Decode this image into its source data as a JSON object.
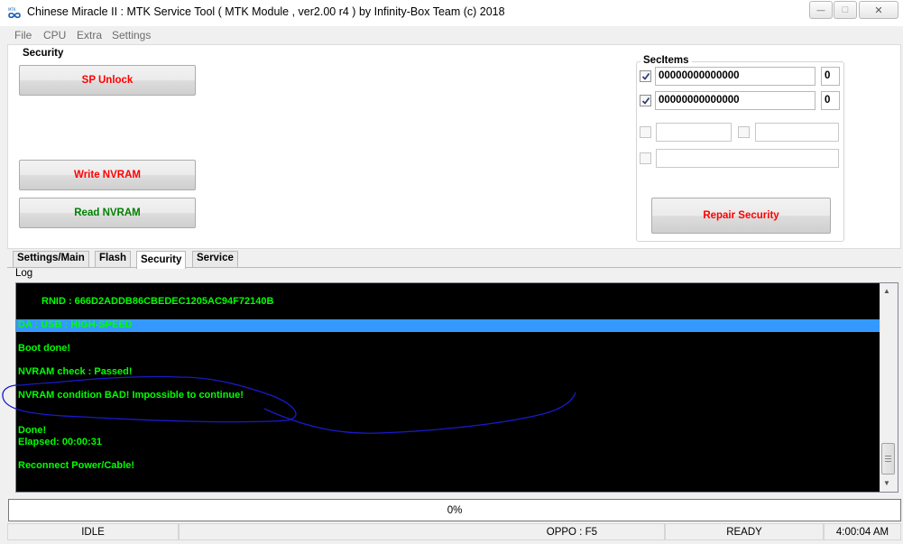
{
  "window": {
    "title": "Chinese Miracle II : MTK Service Tool ( MTK Module , ver2.00 r4  ) by Infinity-Box Team (c) 2018",
    "minimize_glyph": "—",
    "maximize_glyph": "□",
    "close_glyph": "✕",
    "app_icon": "mtk-infinity-icon"
  },
  "menu": [
    "File",
    "CPU",
    "Extra",
    "Settings"
  ],
  "security_group": {
    "title": "Security",
    "sp_unlock_label": "SP Unlock",
    "write_nvram_label": "Write NVRAM",
    "read_nvram_label": "Read NVRAM"
  },
  "secitems": {
    "title": "SecItems",
    "rows": [
      {
        "checked": true,
        "value": "00000000000000",
        "count": "0"
      },
      {
        "checked": true,
        "value": "00000000000000",
        "count": "0"
      }
    ],
    "empty_field_1": "",
    "empty_field_2": "",
    "empty_field_3": "",
    "repair_label": "Repair Security"
  },
  "tabs": [
    "Settings/Main",
    "Flash",
    "Security",
    "Service"
  ],
  "active_tab": "Security",
  "log": {
    "label": "Log",
    "lines": [
      "RNID : 666D2ADDB86CBEDEC1205AC94F72140B",
      "DA : USB : HIGH-SPEED",
      "Boot done!",
      "NVRAM check : Passed!",
      "NVRAM condition BAD! Impossible to continue!",
      "Done!",
      "Elapsed: 00:00:31",
      "Reconnect Power/Cable!"
    ],
    "text_color": "#00ff00",
    "background": "#000000",
    "selection_color": "#3399ff",
    "annotation_color": "#1a1acc"
  },
  "scrollbar": {
    "up_arrow": "▲",
    "down_arrow": "▼"
  },
  "progress": {
    "text": "0%",
    "value": 0
  },
  "statusbar": {
    "state": "IDLE",
    "device": "OPPO : F5",
    "ready": "READY",
    "time": "4:00:04 AM"
  }
}
